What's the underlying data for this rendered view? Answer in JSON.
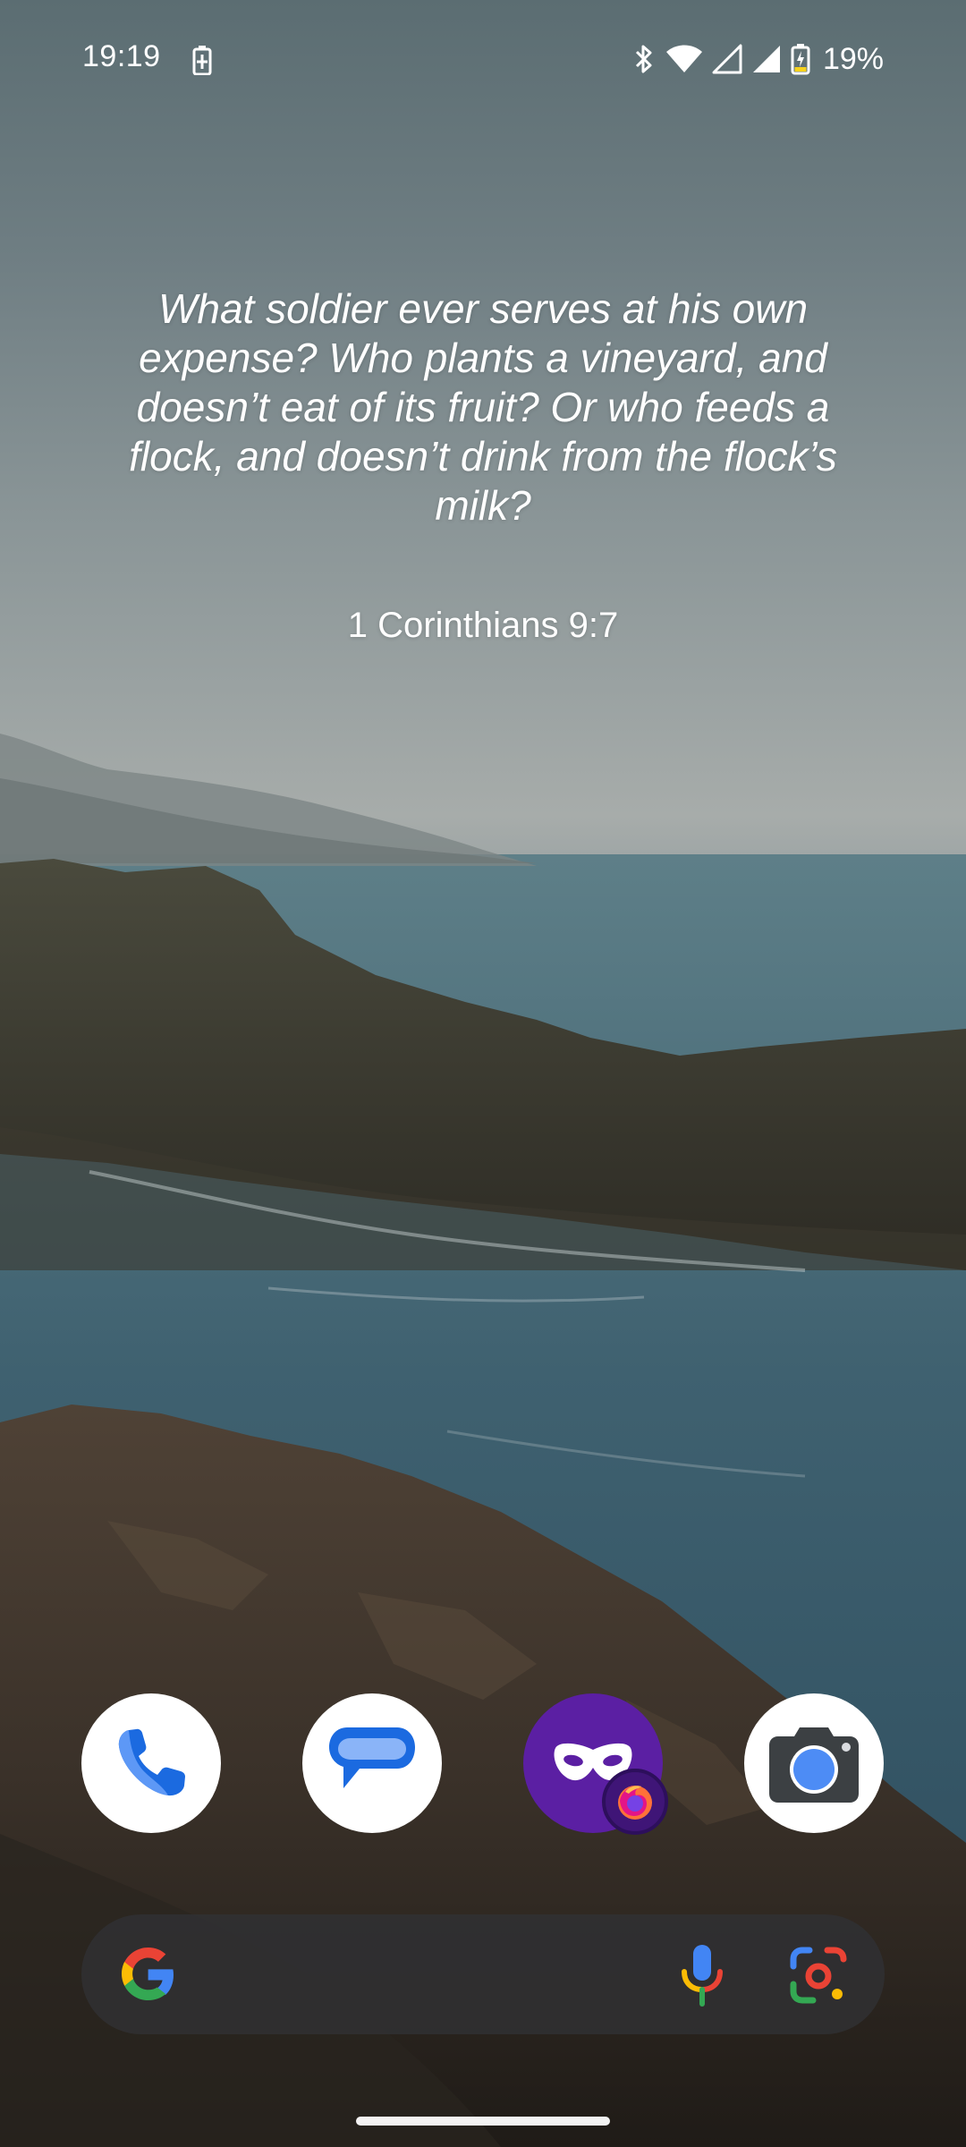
{
  "status_bar": {
    "time": "19:19",
    "battery_percent": "19%",
    "icons": [
      "battery-saver-icon",
      "bluetooth-icon",
      "wifi-icon",
      "signal-icon",
      "signal-icon",
      "battery-charging-icon"
    ]
  },
  "quote_widget": {
    "text": "What soldier ever serves at his own expense? Who plants a vineyard, and doesn’t eat of its fruit? Or who feeds a flock, and doesn’t drink from the flock’s milk?",
    "reference": "1 Corinthians 9:7"
  },
  "dock": {
    "apps": [
      {
        "name": "phone",
        "icon": "phone-icon"
      },
      {
        "name": "messages",
        "icon": "messages-icon"
      },
      {
        "name": "firefox-focus",
        "icon": "mask-icon"
      },
      {
        "name": "camera",
        "icon": "camera-icon"
      }
    ]
  },
  "search_bar": {
    "icons": [
      "google-g-icon",
      "microphone-icon",
      "lens-icon"
    ]
  },
  "colors": {
    "search_bg": "#303032",
    "firefox_purple": "#5b1fa3",
    "google_blue": "#4285f4",
    "google_red": "#ea4335",
    "google_yellow": "#fbbc05",
    "google_green": "#34a853"
  }
}
